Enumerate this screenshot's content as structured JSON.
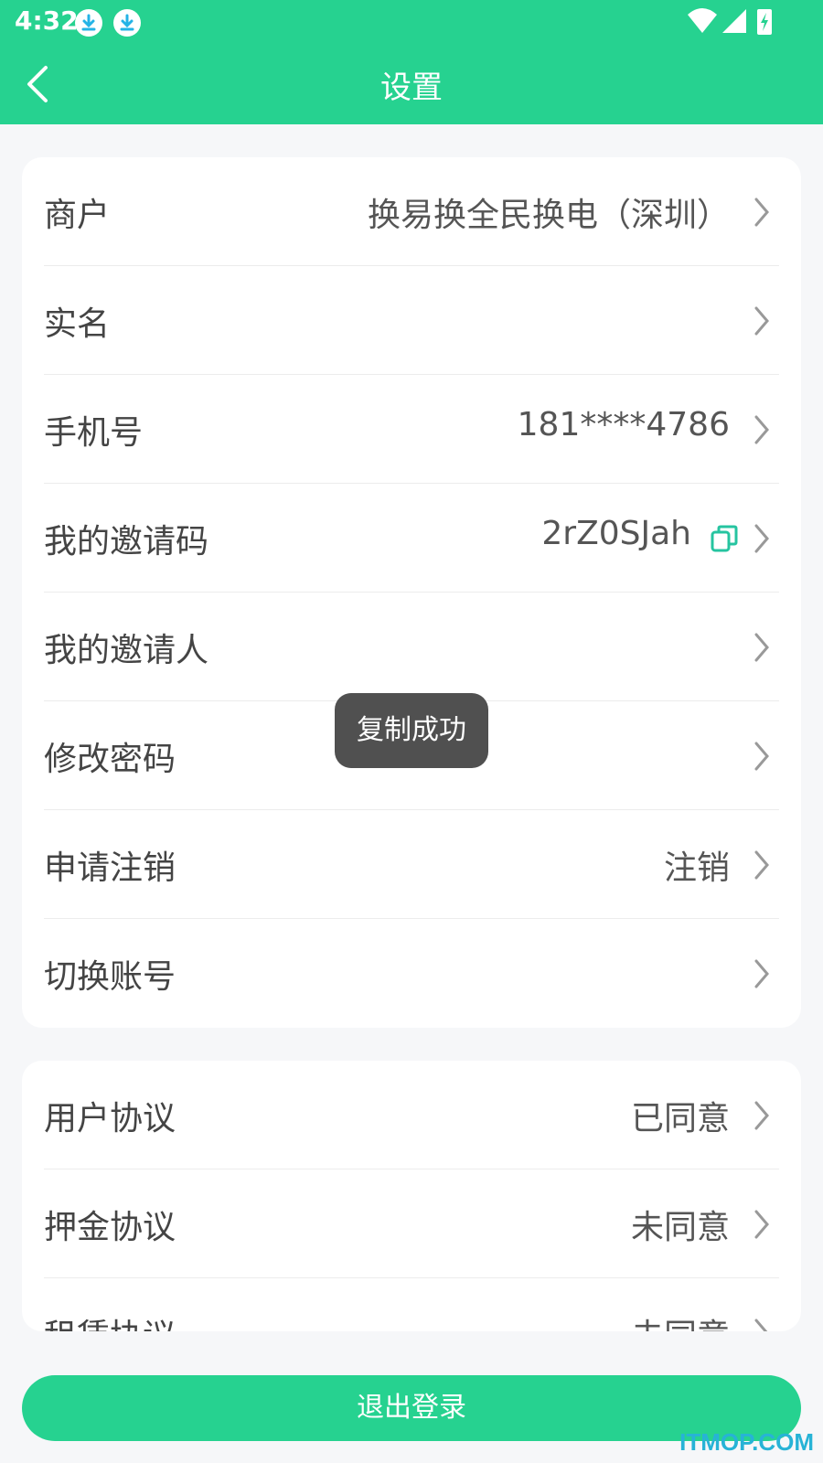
{
  "status_bar": {
    "time": "4:32",
    "icons": [
      "download-icon",
      "download-icon",
      "wifi-icon",
      "signal-icon",
      "battery-charging-icon"
    ]
  },
  "header": {
    "title": "设置",
    "background_color": "#26d290"
  },
  "settings_group_1": [
    {
      "label": "商户",
      "value": "换易换全民换电（深圳）"
    },
    {
      "label": "实名",
      "value": ""
    },
    {
      "label": "手机号",
      "value": "181****4786"
    },
    {
      "label": "我的邀请码",
      "value": "2rZ0SJah"
    },
    {
      "label": "我的邀请人",
      "value": ""
    },
    {
      "label": "修改密码",
      "value": ""
    },
    {
      "label": "申请注销",
      "value": "注销"
    },
    {
      "label": "切换账号",
      "value": ""
    }
  ],
  "settings_group_2": [
    {
      "label": "用户协议",
      "value": "已同意"
    },
    {
      "label": "押金协议",
      "value": "未同意"
    },
    {
      "label": "租赁协议",
      "value": "未同意"
    }
  ],
  "toast": {
    "text": "复制成功"
  },
  "footer": {
    "logout_label": "退出登录"
  },
  "watermark": {
    "text": "ITMOP.COM"
  },
  "colors": {
    "accent": "#26d290",
    "toast_bg": "#505050",
    "page_bg": "#f6f7f9"
  }
}
